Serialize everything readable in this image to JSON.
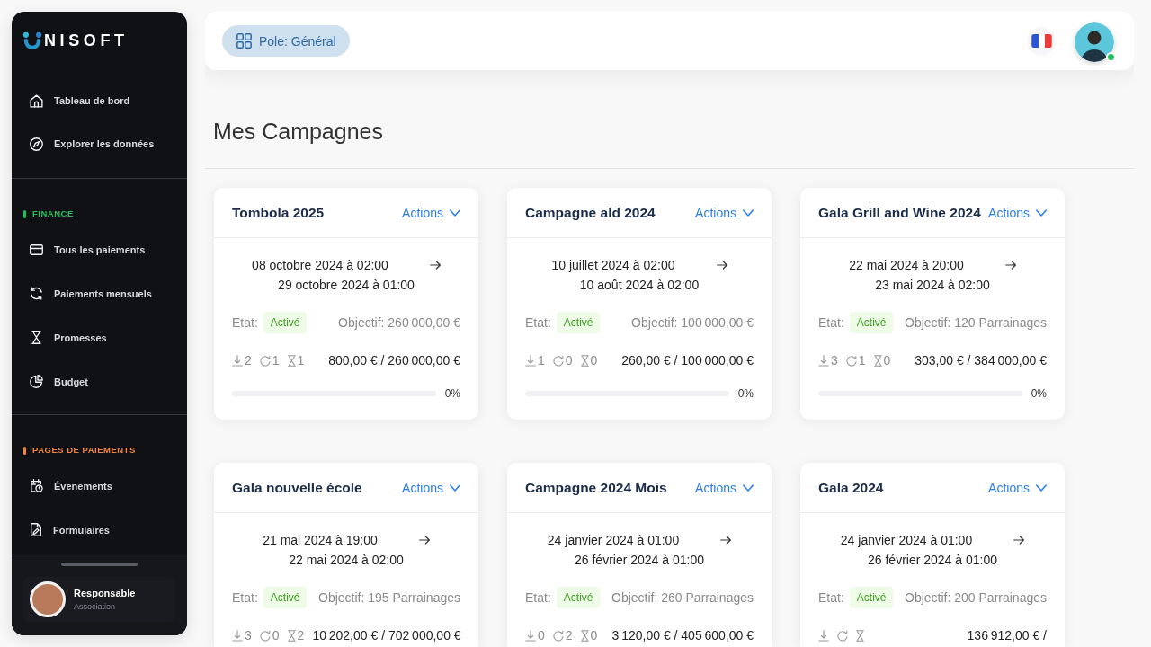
{
  "sidebar": {
    "logo": {
      "text": "NISOFT"
    },
    "items": [
      {
        "label": "Tableau de bord",
        "selected": false
      },
      {
        "label": "Explorer les données",
        "selected": false
      }
    ],
    "sections": [
      {
        "title": "FINANCE",
        "color": "#1fc25d",
        "items": [
          {
            "label": "Tous les paiements",
            "selected": false
          },
          {
            "label": "Paiements mensuels",
            "selected": false
          },
          {
            "label": "Promesses",
            "selected": false
          },
          {
            "label": "Budget",
            "selected": false
          }
        ]
      },
      {
        "title": "PAGES DE PAIEMENTS",
        "color": "#f5843a",
        "items": [
          {
            "label": "Évenements",
            "selected": false
          },
          {
            "label": "Formulaires",
            "selected": false
          }
        ]
      }
    ],
    "user": {
      "name": "Responsable",
      "role": "Association"
    }
  },
  "header": {
    "pole": "Pole: Général",
    "user": {
      "online": true
    }
  },
  "page": {
    "title": "Mes Campagnes"
  },
  "campaigns": [
    {
      "title": "Tombola 2025",
      "actions": "Actions",
      "start": "08 octobre 2024 à 02:00",
      "end": "29 octobre 2024 à 01:00",
      "status_label": "Etat:",
      "status": "Activé",
      "objective": "Objectif: 260 000,00 €",
      "counts": [
        "2",
        "1",
        "1"
      ],
      "amount": "800,00 € / 260 000,00 €",
      "level": 0,
      "percent": "0%"
    },
    {
      "title": "Campagne ald 2024",
      "actions": "Actions",
      "start": "10 juillet 2024 à 02:00",
      "end": "10 août 2024 à 02:00",
      "status_label": "Etat:",
      "status": "Activé",
      "objective": "Objectif: 100 000,00 €",
      "counts": [
        "1",
        "0",
        "0"
      ],
      "amount": "260,00 € / 100 000,00 €",
      "level": 0,
      "percent": "0%"
    },
    {
      "title": "Gala Grill and Wine 2024",
      "actions": "Actions",
      "start": "22 mai 2024 à 20:00",
      "end": "23 mai 2024 à 02:00",
      "status_label": "Etat:",
      "status": "Activé",
      "objective": "Objectif: 120 Parrainages",
      "counts": [
        "3",
        "1",
        "0"
      ],
      "amount": "303,00 € / 384 000,00 €",
      "level": 0,
      "percent": "0%"
    },
    {
      "title": "Gala nouvelle école",
      "actions": "Actions",
      "start": "21 mai 2024 à 19:00",
      "end": "22 mai 2024 à 02:00",
      "status_label": "Etat:",
      "status": "Activé",
      "objective": "Objectif: 195 Parrainages",
      "counts": [
        "3",
        "0",
        "2"
      ],
      "amount": "10 202,00 € / 702 000,00 €"
    },
    {
      "title": "Campagne 2024 Mois",
      "actions": "Actions",
      "start": "24 janvier 2024 à 01:00",
      "end": "26 février 2024 à 01:00",
      "status_label": "Etat:",
      "status": "Activé",
      "objective": "Objectif: 260 Parrainages",
      "counts": [
        "0",
        "2",
        "0"
      ],
      "amount": "3 120,00 € / 405 600,00 €"
    },
    {
      "title": "Gala 2024",
      "actions": "Actions",
      "start": "24 janvier 2024 à 01:00",
      "end": "26 février 2024 à 01:00",
      "status_label": "Etat:",
      "status": "Activé",
      "objective": "Objectif: 200 Parrainages",
      "amount": "136 912,00 € /"
    }
  ]
}
